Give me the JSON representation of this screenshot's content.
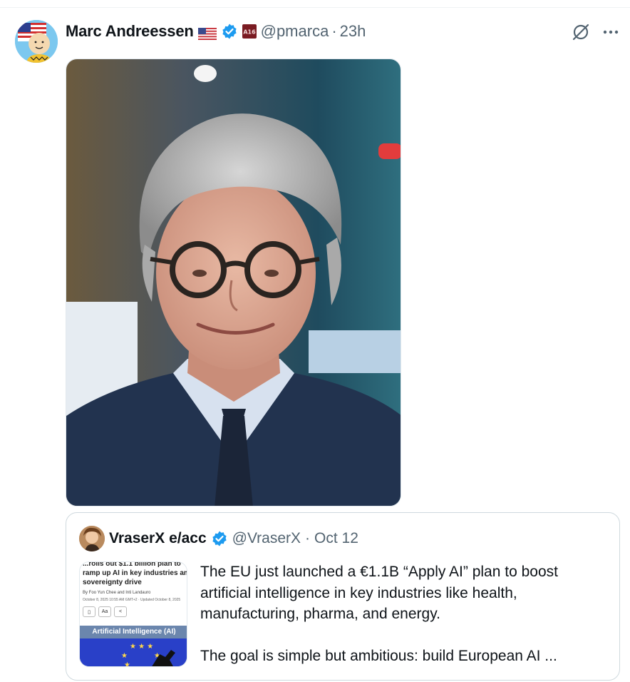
{
  "post": {
    "author_name": "Marc Andreessen",
    "handle": "@pmarca",
    "separator": "·",
    "time": "23h"
  },
  "icons": {
    "flag": "us-flag-icon",
    "verified": "verified-badge-icon",
    "affiliate": "affiliate-badge-icon",
    "grok": "grok-icon",
    "more": "more-options-icon"
  },
  "colors": {
    "verified_blue": "#1d9bf0",
    "secondary_text": "#536471",
    "border": "#cfd9de"
  },
  "quoted": {
    "author_name": "VraserX e/acc",
    "handle": "@VraserX",
    "separator": "·",
    "time": "Oct 12",
    "text_line1": "The EU just launched a €1.1B “Apply AI” plan to boost artificial intelligence in key industries like health, manufacturing, pharma, and energy.",
    "text_line2": "The goal is simple but ambitious: build European AI ...",
    "thumbnail": {
      "headline_1": "...rolls out $1.1 billion plan to",
      "headline_2": "ramp up AI in key industries amid",
      "headline_3": "sovereignty drive",
      "byline": "By Foo Yun Chee and Inti Landauro",
      "date": "October 8, 2025 10:55 AM GMT+2 · Updated October 8, 2025",
      "icon_aa": "Aa",
      "section_label": "Artificial Intelligence (AI)"
    }
  }
}
